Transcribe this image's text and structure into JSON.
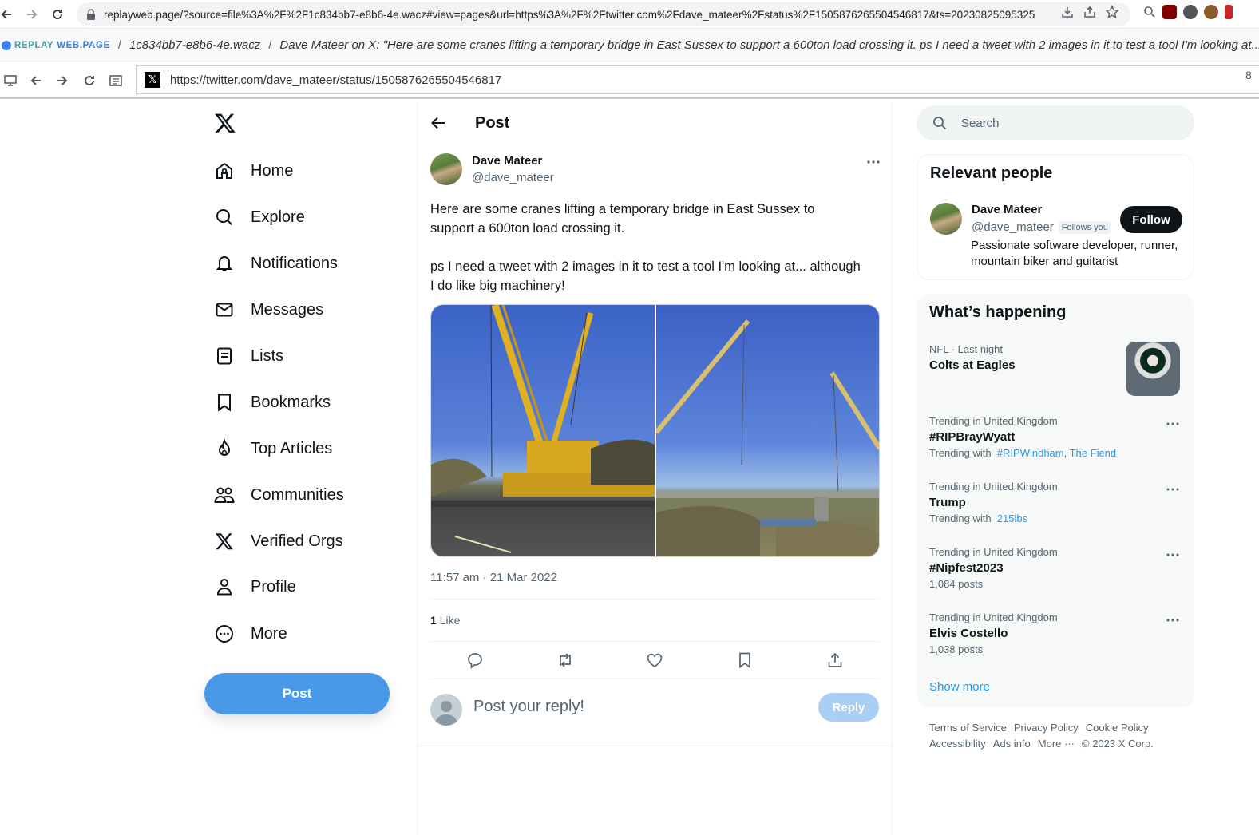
{
  "browser": {
    "url": "replayweb.page/?source=file%3A%2F%2F1c834bb7-e8b6-4e.wacz#view=pages&url=https%3A%2F%2Ftwitter.com%2Fdave_mateer%2Fstatus%2F1505876265504546817&ts=20230825095325"
  },
  "replay": {
    "logo_prefix": "REPLAY",
    "logo_suffix": "WEB.PAGE",
    "archive": "1c834bb7-e8b6-4e.wacz",
    "page_title": "Dave Mateer on X: \"Here are some cranes lifting a temporary bridge in East Sussex to support a 600ton load crossing it. ps I need a tweet with 2 images in it to test a tool I'm looking at... although I do like big machinery!\"",
    "url": "https://twitter.com/dave_mateer/status/1505876265504546817",
    "url_right": "8"
  },
  "nav": {
    "items": [
      {
        "label": "Home",
        "icon": "home-icon"
      },
      {
        "label": "Explore",
        "icon": "search-icon"
      },
      {
        "label": "Notifications",
        "icon": "bell-icon"
      },
      {
        "label": "Messages",
        "icon": "envelope-icon"
      },
      {
        "label": "Lists",
        "icon": "list-icon"
      },
      {
        "label": "Bookmarks",
        "icon": "bookmark-icon"
      },
      {
        "label": "Top Articles",
        "icon": "flame-icon"
      },
      {
        "label": "Communities",
        "icon": "people-icon"
      },
      {
        "label": "Verified Orgs",
        "icon": "x-icon"
      },
      {
        "label": "Profile",
        "icon": "person-icon"
      },
      {
        "label": "More",
        "icon": "more-circle-icon"
      }
    ],
    "post_label": "Post"
  },
  "post": {
    "header_title": "Post",
    "author_name": "Dave Mateer",
    "author_handle": "@dave_mateer",
    "text_p1": "Here are some cranes lifting a temporary bridge in East Sussex to support a 600ton load crossing it.",
    "text_p2": "ps I need a tweet with 2 images in it to test a tool I'm looking at... although I do like big machinery!",
    "timestamp": "11:57 am · 21 Mar 2022",
    "like_count": "1",
    "like_label": " Like",
    "reply_placeholder": "Post your reply!",
    "reply_button": "Reply"
  },
  "sidebar": {
    "search_placeholder": "Search",
    "relevant_title": "Relevant people",
    "person": {
      "name": "Dave Mateer",
      "handle": "@dave_mateer",
      "follows_you": "Follows you",
      "follow_label": "Follow",
      "bio": "Passionate software developer, runner, mountain biker and guitarist"
    },
    "happening_title": "What’s happening",
    "trends": [
      {
        "meta": "NFL · Last night",
        "name": "Colts at Eagles",
        "sub": "",
        "links": []
      },
      {
        "meta": "Trending in United Kingdom",
        "name": "#RIPBrayWyatt",
        "sub": "Trending with",
        "links": [
          "#RIPWindham",
          "The Fiend"
        ]
      },
      {
        "meta": "Trending in United Kingdom",
        "name": "Trump",
        "sub": "Trending with",
        "links": [
          "215lbs"
        ]
      },
      {
        "meta": "Trending in United Kingdom",
        "name": "#Nipfest2023",
        "sub": "1,084 posts",
        "links": []
      },
      {
        "meta": "Trending in United Kingdom",
        "name": "Elvis Costello",
        "sub": "1,038 posts",
        "links": []
      }
    ],
    "show_more": "Show more",
    "footer": [
      "Terms of Service",
      "Privacy Policy",
      "Cookie Policy",
      "Accessibility",
      "Ads info",
      "More ···",
      "© 2023 X Corp."
    ]
  }
}
